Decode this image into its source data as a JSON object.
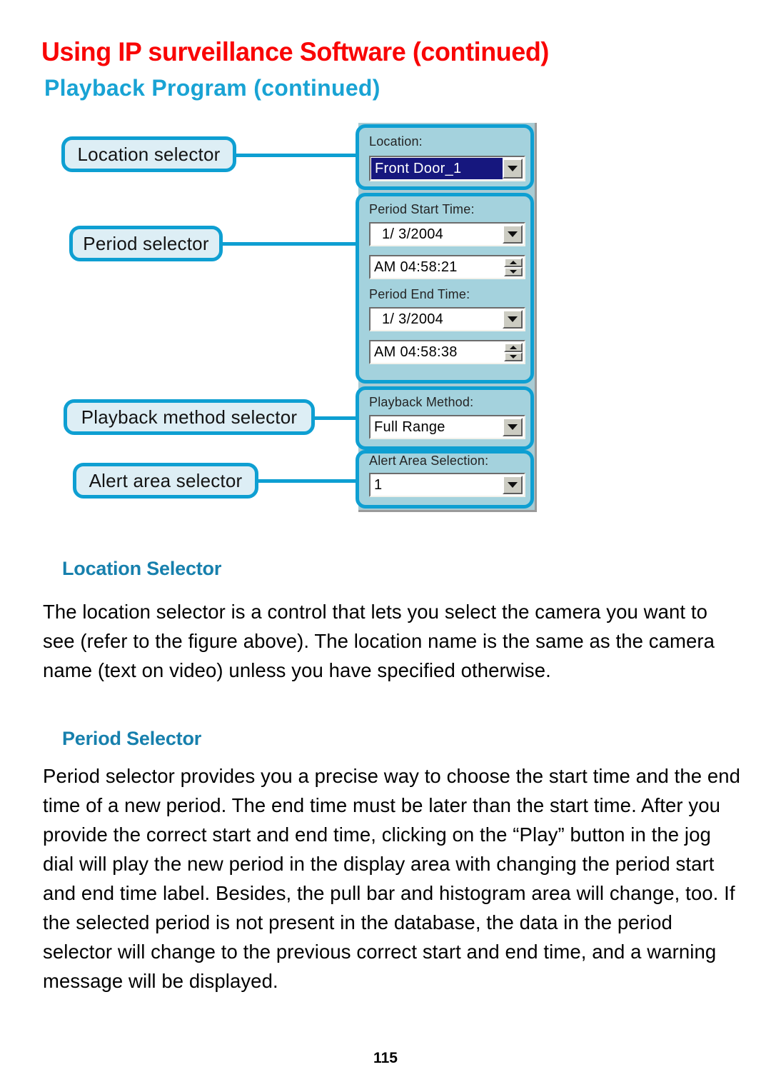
{
  "header": {
    "title": "Using IP surveillance Software (continued)",
    "subtitle": "Playback Program (continued)",
    "title_color": "#f90505",
    "subtitle_color": "#19a3d4"
  },
  "figure": {
    "callouts": [
      {
        "label": "Location selector"
      },
      {
        "label": "Period selector"
      },
      {
        "label": "Playback method selector"
      },
      {
        "label": "Alert area selector"
      }
    ],
    "dialog": {
      "groups": [
        {
          "name": "location",
          "label": "Location:",
          "control": {
            "type": "combobox",
            "value": "Front Door_1",
            "selected": true
          }
        },
        {
          "name": "period",
          "start_label": "Period Start Time:",
          "start_date": "1/  3/2004",
          "start_time": "AM 04:58:21",
          "end_label": "Period End Time:",
          "end_date": "1/  3/2004",
          "end_time": "AM 04:58:38"
        },
        {
          "name": "playback-method",
          "label": "Playback Method:",
          "control": {
            "type": "combobox",
            "value": "Full Range",
            "selected": false
          }
        },
        {
          "name": "alert-area",
          "label": "Alert Area Selection:",
          "control": {
            "type": "combobox",
            "value": "1",
            "selected": false
          }
        }
      ],
      "panel_color": "#a4d2dd",
      "accent_color": "#0e9fd2",
      "selection_color": "#16177e"
    }
  },
  "sections": [
    {
      "heading": "Location Selector",
      "body": "The location selector is a control that lets you select the camera you want to see (refer to the figure above). The location name is the same as the camera name (text on video) unless you have specified otherwise."
    },
    {
      "heading": "Period Selector",
      "body": "Period selector provides you a precise way to choose the start time and the end time of a new period. The end time must be later than the start time. After you provide the correct start and end time, clicking on the “Play” button in the jog dial will play the new period in the display area with changing the period start and end time label. Besides, the pull bar and histogram area will change, too. If the selected period is not present in the database, the data in the period selector will change to the previous correct start and end time, and a warning message will be displayed."
    }
  ],
  "footer": {
    "page_number": "115"
  }
}
